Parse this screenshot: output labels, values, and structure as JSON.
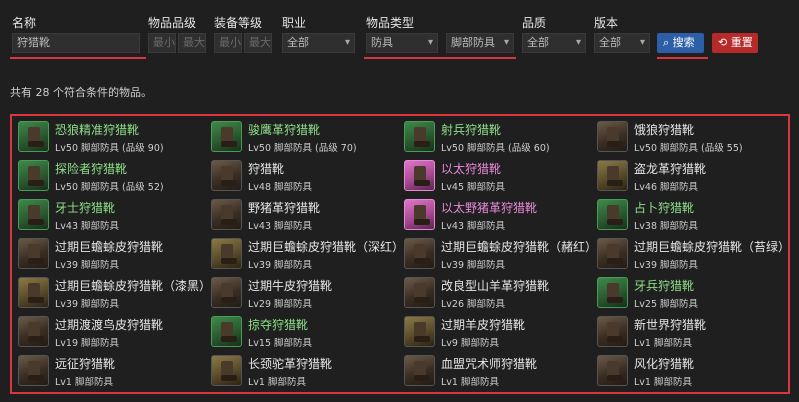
{
  "filters": {
    "name_label": "名称",
    "name_value": "狩猎靴",
    "item_level_label": "物品品级",
    "item_level_min": "最小",
    "item_level_max": "最大",
    "equip_level_label": "装备等级",
    "equip_level_min": "最小",
    "equip_level_max": "最大",
    "job_label": "职业",
    "job_value": "全部",
    "type_label": "物品类型",
    "type_value": "防具",
    "subtype_value": "脚部防具",
    "quality_label": "品质",
    "quality_value": "全部",
    "version_label": "版本",
    "version_value": "全部",
    "search_label": "搜索",
    "reset_label": "重置"
  },
  "summary": "共有 28 个符合条件的物品。",
  "colors": {
    "highlight": "#d9363e",
    "green_name": "#8fe08a",
    "pink_name": "#e98ad8",
    "search_button": "#2c5fa8",
    "reset_button": "#b72a2a"
  },
  "items": [
    {
      "name": "恐狼精准狩猎靴",
      "meta": "Lv50 脚部防具 (品级 90)",
      "rarity": "green"
    },
    {
      "name": "骏鹰革狩猎靴",
      "meta": "Lv50 脚部防具 (品级 70)",
      "rarity": "green"
    },
    {
      "name": "射兵狩猎靴",
      "meta": "Lv50 脚部防具 (品级 60)",
      "rarity": "green"
    },
    {
      "name": "饿狼狩猎靴",
      "meta": "Lv50 脚部防具 (品级 55)",
      "rarity": "normal"
    },
    {
      "name": "探险者狩猎靴",
      "meta": "Lv50 脚部防具 (品级 52)",
      "rarity": "green"
    },
    {
      "name": "狩猎靴",
      "meta": "Lv48 脚部防具",
      "rarity": "normal"
    },
    {
      "name": "以太狩猎靴",
      "meta": "Lv45 脚部防具",
      "rarity": "pink"
    },
    {
      "name": "盗龙革狩猎靴",
      "meta": "Lv46 脚部防具",
      "rarity": "normal"
    },
    {
      "name": "牙士狩猎靴",
      "meta": "Lv43 脚部防具",
      "rarity": "green"
    },
    {
      "name": "野猪革狩猎靴",
      "meta": "Lv43 脚部防具",
      "rarity": "normal"
    },
    {
      "name": "以太野猪革狩猎靴",
      "meta": "Lv43 脚部防具",
      "rarity": "pink"
    },
    {
      "name": "占卜狩猎靴",
      "meta": "Lv38 脚部防具",
      "rarity": "green"
    },
    {
      "name": "过期巨蟾蜍皮狩猎靴",
      "meta": "Lv39 脚部防具",
      "rarity": "normal"
    },
    {
      "name": "过期巨蟾蜍皮狩猎靴（深红）",
      "meta": "Lv39 脚部防具",
      "rarity": "normal"
    },
    {
      "name": "过期巨蟾蜍皮狩猎靴（赭红）",
      "meta": "Lv39 脚部防具",
      "rarity": "normal"
    },
    {
      "name": "过期巨蟾蜍皮狩猎靴（苔绿）",
      "meta": "Lv39 脚部防具",
      "rarity": "normal"
    },
    {
      "name": "过期巨蟾蜍皮狩猎靴（漆黑）",
      "meta": "Lv39 脚部防具",
      "rarity": "normal"
    },
    {
      "name": "过期牛皮狩猎靴",
      "meta": "Lv29 脚部防具",
      "rarity": "normal"
    },
    {
      "name": "改良型山羊革狩猎靴",
      "meta": "Lv26 脚部防具",
      "rarity": "normal"
    },
    {
      "name": "牙兵狩猎靴",
      "meta": "Lv25 脚部防具",
      "rarity": "green"
    },
    {
      "name": "过期渡渡鸟皮狩猎靴",
      "meta": "Lv19 脚部防具",
      "rarity": "normal"
    },
    {
      "name": "掠夺狩猎靴",
      "meta": "Lv15 脚部防具",
      "rarity": "green"
    },
    {
      "name": "过期羊皮狩猎靴",
      "meta": "Lv9 脚部防具",
      "rarity": "normal"
    },
    {
      "name": "新世界狩猎靴",
      "meta": "Lv1 脚部防具",
      "rarity": "normal"
    },
    {
      "name": "远征狩猎靴",
      "meta": "Lv1 脚部防具",
      "rarity": "normal"
    },
    {
      "name": "长颈驼革狩猎靴",
      "meta": "Lv1 脚部防具",
      "rarity": "normal"
    },
    {
      "name": "血盟咒术师狩猎靴",
      "meta": "Lv1 脚部防具",
      "rarity": "normal"
    },
    {
      "name": "风化狩猎靴",
      "meta": "Lv1 脚部防具",
      "rarity": "normal"
    }
  ]
}
